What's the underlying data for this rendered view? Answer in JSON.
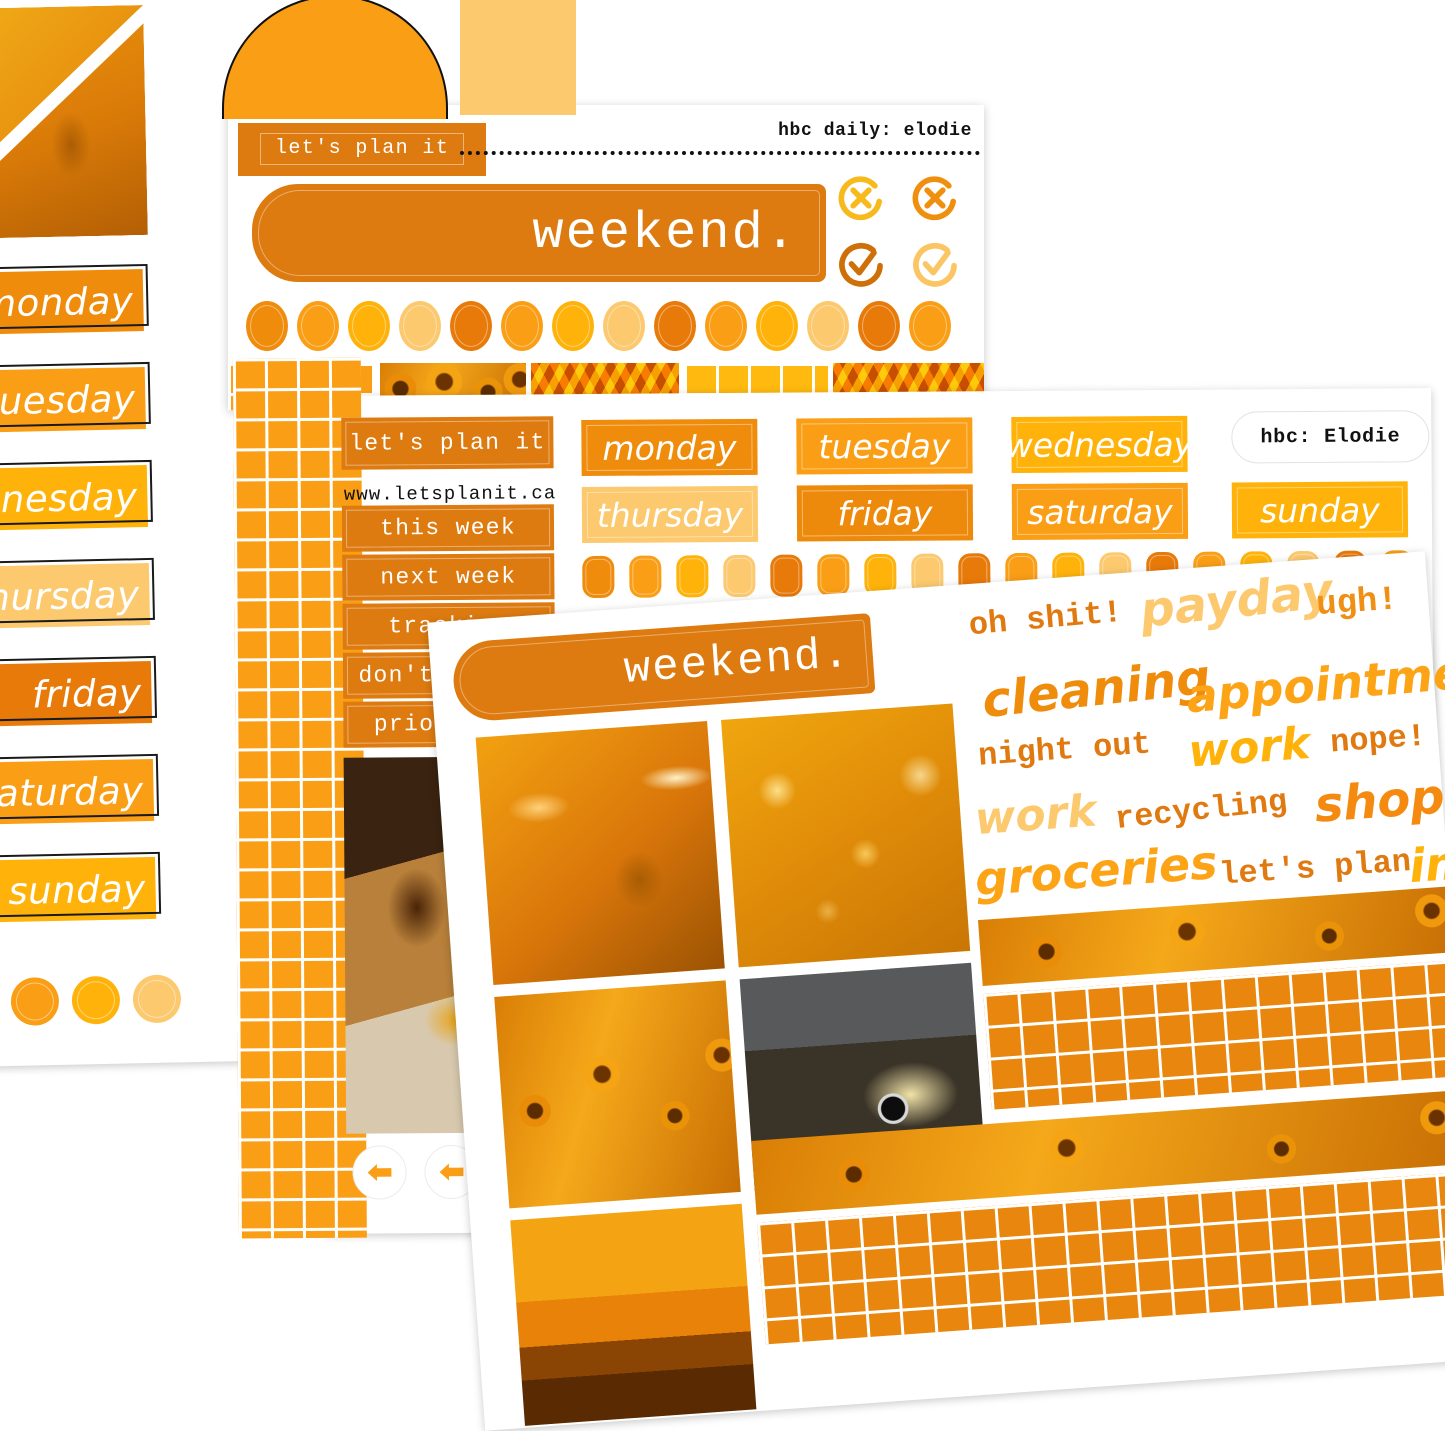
{
  "palette": {
    "deep_orange": "#f08c0c",
    "orange": "#fa9e16",
    "golden": "#ffb30a",
    "peach": "#fcc96e",
    "darkest": "#e87a0a",
    "brand": "#dd7b10"
  },
  "back_sheet": {
    "days": [
      {
        "label": "monday",
        "color": "#f08c0c"
      },
      {
        "label": "tuesday",
        "color": "#fa9e16"
      },
      {
        "label": "wednesday",
        "color": "#ffb30a"
      },
      {
        "label": "thursday",
        "color": "#fcc96e"
      },
      {
        "label": "friday",
        "color": "#ef8b0b"
      },
      {
        "label": "saturday",
        "color": "#fa9e16"
      },
      {
        "label": "sunday",
        "color": "#ffb30a"
      }
    ],
    "dots": [
      "#f08c0c",
      "#fa9e16",
      "#ffb30a",
      "#fcc96e"
    ]
  },
  "top_sheet": {
    "brand_tag": "let's plan it",
    "corner_label": "hbc daily: elodie",
    "header_label": "weekend.",
    "icons": [
      {
        "name": "circle-x-icon",
        "color": "#f7b91c"
      },
      {
        "name": "circle-x-icon",
        "color": "#ef8f0d"
      },
      {
        "name": "circle-check-icon",
        "color": "#cf6f07"
      },
      {
        "name": "circle-check-icon",
        "color": "#f8c濃"
      }
    ],
    "dot_colors": [
      "#f08c0c",
      "#fa9e16",
      "#ffb30a",
      "#fcc96e",
      "#ef8208",
      "#f7960e",
      "#ffb80b",
      "#fccb78",
      "#ef8208",
      "#fa9e16",
      "#ffb30a",
      "#fcc96e",
      "#ef8208",
      "#fa9e16"
    ],
    "strips": [
      "grid-washi",
      "sunflower-photo",
      "knit-photo",
      "yellow-grid-washi",
      "knit-photo"
    ]
  },
  "mid_sheet": {
    "brand_tag": "let's plan it",
    "url": "www.letsplanit.ca",
    "menu": [
      "this week",
      "next week",
      "tracking",
      "don't forget",
      "priorities"
    ],
    "days_row1": [
      {
        "label": "monday",
        "color": "#f08c0c"
      },
      {
        "label": "tuesday",
        "color": "#fa9e16"
      },
      {
        "label": "wednesday",
        "color": "#ffb30a"
      }
    ],
    "days_row2": [
      {
        "label": "thursday",
        "color": "#fcc96e"
      },
      {
        "label": "friday",
        "color": "#ee8a0b"
      },
      {
        "label": "saturday",
        "color": "#fa9e16"
      },
      {
        "label": "sunday",
        "color": "#ffb30a"
      }
    ],
    "hbc_tag": "hbc: Elodie",
    "small_rects": [
      "#f08c0c",
      "#fa9e16",
      "#ffb30a",
      "#fcc96e",
      "#ee8509",
      "#f79712",
      "#ffb80b",
      "#fccb78",
      "#ee8509",
      "#f79712",
      "#ffb30a",
      "#fcc96e",
      "#ef8208",
      "#fa9e16",
      "#ffb30a",
      "#fcc96e",
      "#ee8509",
      "#fa9e16"
    ],
    "big_squares": [
      "#fcbe4e",
      "#ffb30a",
      "#f79a22",
      "#fcc96e",
      "#ffb30a",
      "#fcc268"
    ],
    "arrows": [
      "left-arrow-icon",
      "left-arrow-icon",
      "left-arrow-icon"
    ]
  },
  "front_sheet": {
    "header_label": "weekend.",
    "photos": [
      "autumn-leaves",
      "yellow-bokeh",
      "sunflower-field",
      "vw-beetle",
      "sunset-clouds"
    ],
    "words": [
      {
        "text": "oh shit!",
        "style": "mono",
        "color": "#e07a10"
      },
      {
        "text": "payday",
        "style": "script",
        "color": "#fcc96e"
      },
      {
        "text": "ugh!",
        "style": "mono",
        "color": "#ef8f14"
      },
      {
        "text": "cleaning",
        "style": "script",
        "color": "#f08c0c"
      },
      {
        "text": "appointment",
        "style": "script",
        "color": "#fca316"
      },
      {
        "text": "night out",
        "style": "mono",
        "color": "#e07a10"
      },
      {
        "text": "work",
        "style": "script",
        "color": "#ffb30a"
      },
      {
        "text": "nope!",
        "style": "mono",
        "color": "#e07a10"
      },
      {
        "text": "work",
        "style": "script",
        "color": "#fcc96e"
      },
      {
        "text": "recycling",
        "style": "mono",
        "color": "#e07a10"
      },
      {
        "text": "shopping",
        "style": "script",
        "color": "#f58a10"
      },
      {
        "text": "groceries",
        "style": "script",
        "color": "#fca316"
      },
      {
        "text": "let's plan",
        "style": "mono",
        "color": "#e07a10"
      },
      {
        "text": "im",
        "style": "script",
        "color": "#ffb30a"
      }
    ],
    "washi": [
      "sunflower-strip",
      "grid-strip",
      "sunflower-strip",
      "grid-strip"
    ]
  }
}
